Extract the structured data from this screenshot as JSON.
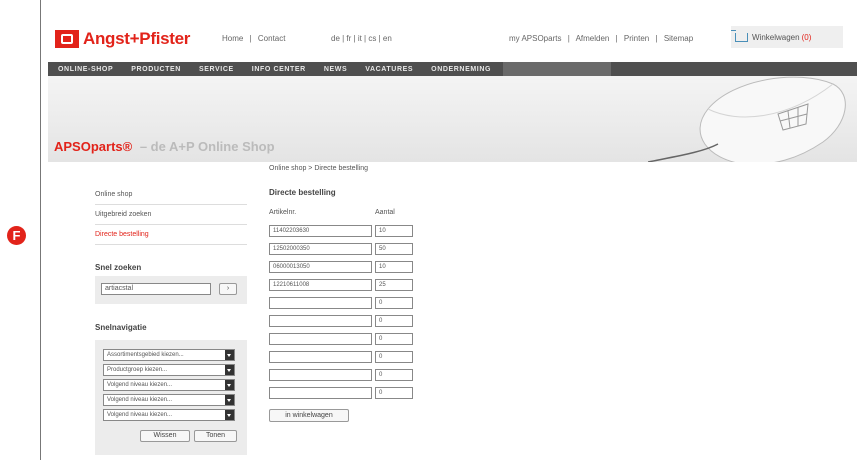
{
  "header": {
    "logo_text": "Angst+Pfister",
    "topnav": [
      "Home",
      "|",
      "Contact"
    ],
    "langs": "de | fr | it | cs | en",
    "rightnav": [
      "my APSOparts",
      "|",
      "Afmelden",
      "|",
      "Printen",
      "|",
      "Sitemap"
    ],
    "cart_label": "Winkelwagen",
    "cart_count": "(0)"
  },
  "mainnav": [
    "ONLINE-SHOP",
    "PRODUCTEN",
    "SERVICE",
    "INFO CENTER",
    "NEWS",
    "VACATURES",
    "ONDERNEMING"
  ],
  "banner": {
    "title": "APSOparts®",
    "subtitle": "– de A+P Online Shop"
  },
  "breadcrumb": "Online shop > Directe bestelling",
  "sidebar": {
    "links": [
      "Online shop",
      "Uitgebreid zoeken",
      "Directe bestelling"
    ],
    "marker": "F",
    "snel_zoeken_title": "Snel zoeken",
    "snel_zoeken_value": "artiacstal",
    "snel_zoeken_button": "›",
    "snelnav_title": "Snelnavigatie",
    "selects": [
      "Assortimentsgebied kiezen...",
      "Productgroep kiezen...",
      "Volgend niveau kiezen...",
      "Volgend niveau kiezen...",
      "Volgend niveau kiezen..."
    ],
    "wissen": "Wissen",
    "tonen": "Tonen"
  },
  "order": {
    "title": "Directe bestelling",
    "col_art": "Artikelnr.",
    "col_qty": "Aantal",
    "rows": [
      {
        "art": "11402203630",
        "qty": "10"
      },
      {
        "art": "12502000350",
        "qty": "50"
      },
      {
        "art": "06000013050",
        "qty": "10"
      },
      {
        "art": "12210611008",
        "qty": "25"
      },
      {
        "art": "",
        "qty": "0"
      },
      {
        "art": "",
        "qty": "0"
      },
      {
        "art": "",
        "qty": "0"
      },
      {
        "art": "",
        "qty": "0"
      },
      {
        "art": "",
        "qty": "0"
      },
      {
        "art": "",
        "qty": "0"
      }
    ],
    "cart_button": "in winkelwagen"
  },
  "colors": {
    "brand_red": "#e2231a",
    "nav_bg": "#4f4f4f"
  }
}
